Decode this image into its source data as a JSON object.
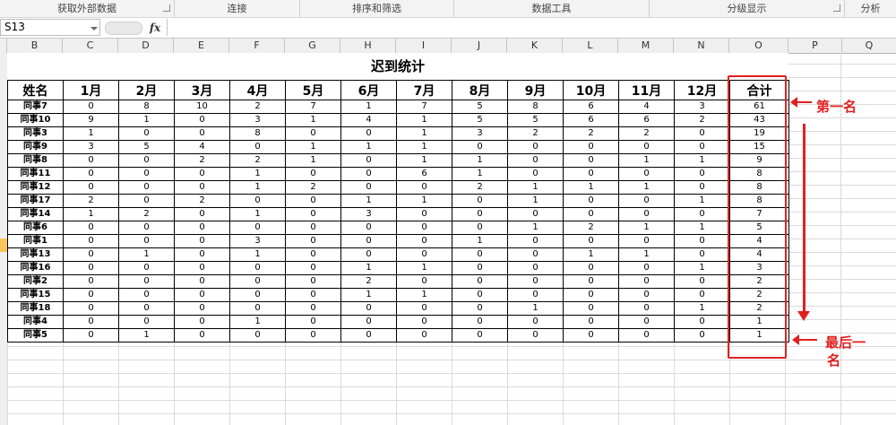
{
  "ribbon": {
    "groups": [
      "获取外部数据",
      "连接",
      "排序和筛选",
      "数据工具",
      "分级显示",
      "分析"
    ]
  },
  "formula_bar": {
    "name_box": "S13",
    "fx_label": "fx",
    "value": ""
  },
  "columns": [
    "B",
    "C",
    "D",
    "E",
    "F",
    "G",
    "H",
    "I",
    "J",
    "K",
    "L",
    "M",
    "N",
    "O",
    "P",
    "Q"
  ],
  "table": {
    "title": "迟到统计",
    "headers": [
      "姓名",
      "1月",
      "2月",
      "3月",
      "4月",
      "5月",
      "6月",
      "7月",
      "8月",
      "9月",
      "10月",
      "11月",
      "12月",
      "合计"
    ],
    "rows": [
      [
        "同事7",
        "0",
        "8",
        "10",
        "2",
        "7",
        "1",
        "7",
        "5",
        "8",
        "6",
        "4",
        "3",
        "61"
      ],
      [
        "同事10",
        "9",
        "1",
        "0",
        "3",
        "1",
        "4",
        "1",
        "5",
        "5",
        "6",
        "6",
        "2",
        "43"
      ],
      [
        "同事3",
        "1",
        "0",
        "0",
        "8",
        "0",
        "0",
        "1",
        "3",
        "2",
        "2",
        "2",
        "0",
        "19"
      ],
      [
        "同事9",
        "3",
        "5",
        "4",
        "0",
        "1",
        "1",
        "1",
        "0",
        "0",
        "0",
        "0",
        "0",
        "15"
      ],
      [
        "同事8",
        "0",
        "0",
        "2",
        "2",
        "1",
        "0",
        "1",
        "1",
        "0",
        "0",
        "1",
        "1",
        "9"
      ],
      [
        "同事11",
        "0",
        "0",
        "0",
        "1",
        "0",
        "0",
        "6",
        "1",
        "0",
        "0",
        "0",
        "0",
        "8"
      ],
      [
        "同事12",
        "0",
        "0",
        "0",
        "1",
        "2",
        "0",
        "0",
        "2",
        "1",
        "1",
        "1",
        "0",
        "8"
      ],
      [
        "同事17",
        "2",
        "0",
        "2",
        "0",
        "0",
        "1",
        "1",
        "0",
        "1",
        "0",
        "0",
        "1",
        "8"
      ],
      [
        "同事14",
        "1",
        "2",
        "0",
        "1",
        "0",
        "3",
        "0",
        "0",
        "0",
        "0",
        "0",
        "0",
        "7"
      ],
      [
        "同事6",
        "0",
        "0",
        "0",
        "0",
        "0",
        "0",
        "0",
        "0",
        "1",
        "2",
        "1",
        "1",
        "5"
      ],
      [
        "同事1",
        "0",
        "0",
        "0",
        "3",
        "0",
        "0",
        "0",
        "1",
        "0",
        "0",
        "0",
        "0",
        "4"
      ],
      [
        "同事13",
        "0",
        "1",
        "0",
        "1",
        "0",
        "0",
        "0",
        "0",
        "0",
        "1",
        "1",
        "0",
        "4"
      ],
      [
        "同事16",
        "0",
        "0",
        "0",
        "0",
        "0",
        "1",
        "1",
        "0",
        "0",
        "0",
        "0",
        "1",
        "3"
      ],
      [
        "同事2",
        "0",
        "0",
        "0",
        "0",
        "0",
        "2",
        "0",
        "0",
        "0",
        "0",
        "0",
        "0",
        "2"
      ],
      [
        "同事15",
        "0",
        "0",
        "0",
        "0",
        "0",
        "1",
        "1",
        "0",
        "0",
        "0",
        "0",
        "0",
        "2"
      ],
      [
        "同事18",
        "0",
        "0",
        "0",
        "0",
        "0",
        "0",
        "0",
        "0",
        "1",
        "0",
        "0",
        "1",
        "2"
      ],
      [
        "同事4",
        "0",
        "0",
        "0",
        "1",
        "0",
        "0",
        "0",
        "0",
        "0",
        "0",
        "0",
        "0",
        "1"
      ],
      [
        "同事5",
        "0",
        "1",
        "0",
        "0",
        "0",
        "0",
        "0",
        "0",
        "0",
        "0",
        "0",
        "0",
        "1"
      ]
    ]
  },
  "annotations": {
    "first_label": "第一名",
    "last_label_line1": "最后一",
    "last_label_line2": "名",
    "accent_color": "#e02020"
  },
  "icons": {
    "arrow_to_first": "arrow-left-icon",
    "arrow_down": "arrow-down-icon",
    "arrow_to_last": "arrow-left-icon"
  }
}
